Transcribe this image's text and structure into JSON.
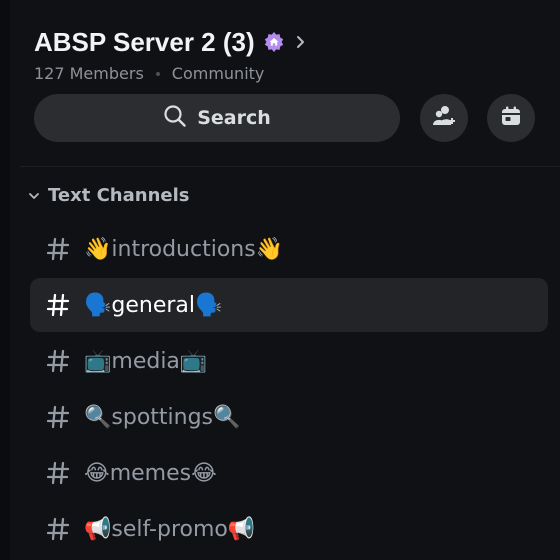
{
  "server": {
    "name": "ABSP Server 2 (3)",
    "members": "127 Members",
    "type": "Community",
    "badge_icon": "community-home-badge-icon",
    "expand_icon": "chevron-right-icon"
  },
  "actions": {
    "search_label": "Search",
    "search_icon": "search-icon",
    "invite_icon": "add-member-icon",
    "events_icon": "calendar-icon"
  },
  "category": {
    "label": "Text Channels",
    "icon": "chevron-down-icon"
  },
  "channels": [
    {
      "name": "👋introductions👋",
      "active": false
    },
    {
      "name": "🗣️general🗣️",
      "active": true
    },
    {
      "name": "📺media📺",
      "active": false
    },
    {
      "name": "🔍spottings🔍",
      "active": false
    },
    {
      "name": "😂memes😂",
      "active": false
    },
    {
      "name": "📢self-promo📢",
      "active": false
    }
  ],
  "colors": {
    "background": "#101114",
    "active_row": "#232428",
    "button": "#2b2d31",
    "badge": "#b48cf0"
  }
}
